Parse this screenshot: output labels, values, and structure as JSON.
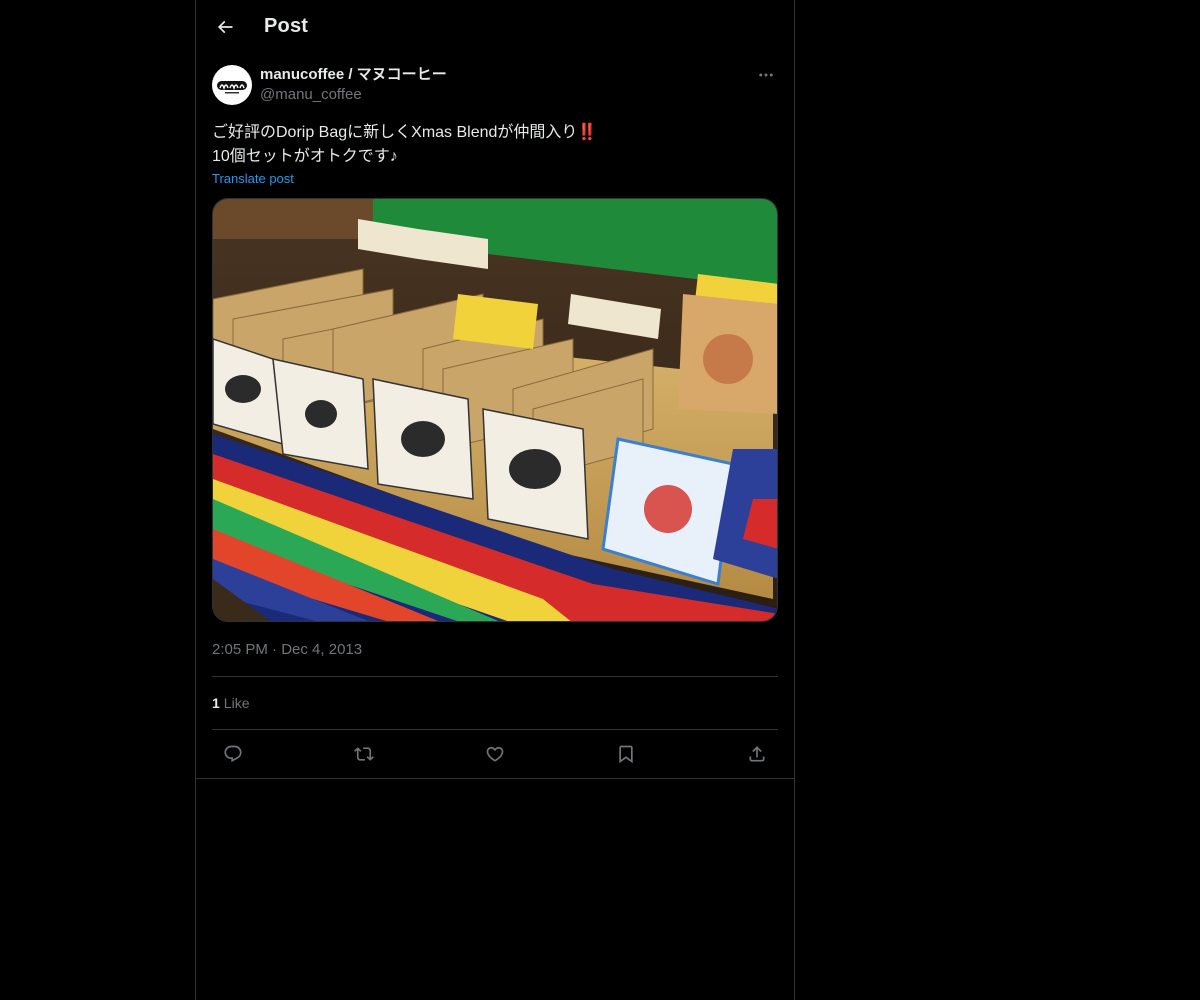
{
  "header": {
    "title": "Post",
    "back_icon": "arrow-left-icon"
  },
  "post": {
    "author": {
      "display_name": "manucoffee / マヌコーヒー",
      "handle": "@manu_coffee",
      "avatar_icon": "manu-logo-icon"
    },
    "text_line1": "ご好評のDorip Bagに新しくXmas Blendが仲間入り",
    "text_emoji": "‼️",
    "text_line2": "10個セットがオトクです♪",
    "translate_label": "Translate post",
    "time": "2:05 PM",
    "separator": "·",
    "date": "Dec 4, 2013",
    "likes_count": "1",
    "likes_label": "Like"
  },
  "actions": [
    {
      "name": "reply",
      "icon": "reply-icon"
    },
    {
      "name": "repost",
      "icon": "repost-icon"
    },
    {
      "name": "like",
      "icon": "heart-icon"
    },
    {
      "name": "bookmark",
      "icon": "bookmark-icon"
    },
    {
      "name": "share",
      "icon": "share-icon"
    }
  ],
  "colors": {
    "background": "#000000",
    "text": "#e7e9ea",
    "muted": "#71767b",
    "link": "#1d9bf0",
    "border": "#2f3336"
  }
}
